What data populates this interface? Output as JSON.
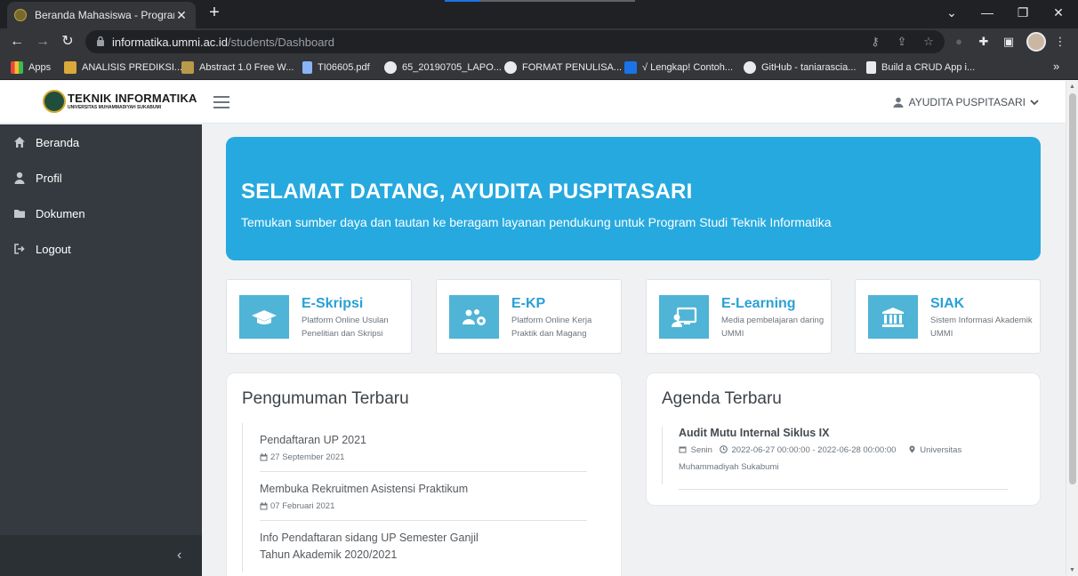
{
  "browser": {
    "tab_title": "Beranda Mahasiswa - Program St",
    "tab_close": "✕",
    "new_tab": "+",
    "url_host": "informatika.ummi.ac.id",
    "url_path": "/students/Dashboard",
    "bookmarks": [
      {
        "label": "Apps",
        "color": "#e8453c"
      },
      {
        "label": "ANALISIS PREDIKSI...",
        "color": "#d9a93b"
      },
      {
        "label": "Abstract 1.0 Free W...",
        "color": "#b89a4a"
      },
      {
        "label": "TI06605.pdf",
        "color": "#8ab4f8"
      },
      {
        "label": "65_20190705_LAPO...",
        "color": "#e8eaed"
      },
      {
        "label": "FORMAT PENULISA...",
        "color": "#e8eaed"
      },
      {
        "label": "√ Lengkap! Contoh...",
        "color": "#1a73e8"
      },
      {
        "label": "GitHub - taniarascia...",
        "color": "#e8eaed"
      },
      {
        "label": "Build a CRUD App i...",
        "color": "#e8eaed"
      }
    ],
    "bookmarks_more": "»"
  },
  "header": {
    "logo_main": "TEKNIK INFORMATIKA",
    "logo_sub": "UNIVERSITAS MUHAMMADIYAH SUKABUMI",
    "user_name": "AYUDITA PUSPITASARI"
  },
  "sidebar": {
    "items": [
      {
        "label": "Beranda",
        "icon": "home-icon"
      },
      {
        "label": "Profil",
        "icon": "user-icon"
      },
      {
        "label": "Dokumen",
        "icon": "folder-icon"
      },
      {
        "label": "Logout",
        "icon": "sign-out-icon"
      }
    ],
    "collapse_glyph": "‹"
  },
  "hero": {
    "title": "SELAMAT DATANG, AYUDITA PUSPITASARI",
    "subtitle": "Temukan sumber daya dan tautan ke beragam layanan pendukung untuk Program Studi Teknik Informatika"
  },
  "quick_links": [
    {
      "title": "E-Skripsi",
      "desc": "Platform Online Usulan Penelitian dan Skripsi",
      "icon": "graduation-cap-icon"
    },
    {
      "title": "E-KP",
      "desc": "Platform Online Kerja Praktik dan Magang",
      "icon": "users-cog-icon"
    },
    {
      "title": "E-Learning",
      "desc": "Media pembelajaran daring UMMI",
      "icon": "chalkboard-teacher-icon"
    },
    {
      "title": "SIAK",
      "desc": "Sistem Informasi Akademik UMMI",
      "icon": "university-icon"
    }
  ],
  "announcements": {
    "heading": "Pengumuman Terbaru",
    "items": [
      {
        "title": "Pendaftaran UP 2021",
        "date": "27 September 2021"
      },
      {
        "title": "Membuka Rekruitmen Asistensi Praktikum",
        "date": "07 Februari 2021"
      },
      {
        "title": "Info Pendaftaran sidang UP Semester Ganjil Tahun Akademik 2020/2021",
        "date": ""
      }
    ]
  },
  "agenda": {
    "heading": "Agenda Terbaru",
    "items": [
      {
        "title": "Audit Mutu Internal Siklus IX",
        "day": "Senin",
        "time": "2022-06-27 00:00:00 - 2022-06-28 00:00:00",
        "location": "Universitas Muhammadiyah Sukabumi"
      }
    ]
  },
  "colors": {
    "hero_bg": "#26a9df",
    "accent": "#2aa1d5",
    "sidebar_bg": "#343a40",
    "icon_tile": "#4fb4d6"
  }
}
